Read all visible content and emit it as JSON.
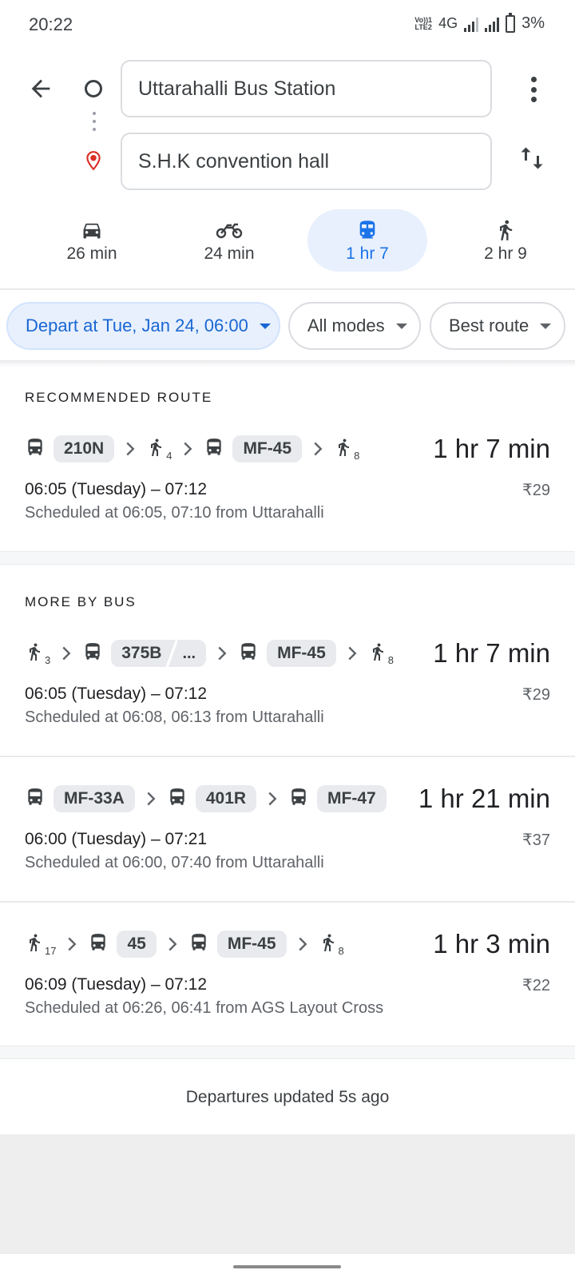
{
  "status": {
    "time": "20:22",
    "volte_line1": "Vo))1",
    "volte_line2": "LTE2",
    "network": "4G",
    "battery": "3%"
  },
  "search": {
    "origin": "Uttarahalli Bus Station",
    "destination": "S.H.K convention hall"
  },
  "modes": [
    {
      "label": "26 min",
      "icon": "car-icon"
    },
    {
      "label": "24 min",
      "icon": "motorcycle-icon"
    },
    {
      "label": "1 hr 7",
      "icon": "transit-icon",
      "selected": true
    },
    {
      "label": "2 hr 9",
      "icon": "walk-icon"
    }
  ],
  "filters": {
    "depart": "Depart at Tue, Jan 24, 06:00",
    "modes": "All modes",
    "sort": "Best route"
  },
  "recommended": {
    "title": "RECOMMENDED ROUTE",
    "route": {
      "steps": [
        {
          "type": "bus",
          "label": "210N"
        },
        {
          "type": "walk",
          "minutes": "4"
        },
        {
          "type": "bus",
          "label": "MF-45"
        },
        {
          "type": "walk",
          "minutes": "8"
        }
      ],
      "duration": "1 hr 7 min",
      "times": "06:05 (Tuesday) – 07:12",
      "schedule": "Scheduled at 06:05, 07:10 from Uttarahalli",
      "fare": "₹29"
    }
  },
  "more_by_bus": {
    "title": "MORE BY BUS",
    "routes": [
      {
        "steps": [
          {
            "type": "walk",
            "minutes": "3"
          },
          {
            "type": "bus",
            "label": "375B",
            "extra": "..."
          },
          {
            "type": "bus",
            "label": "MF-45"
          },
          {
            "type": "walk",
            "minutes": "8"
          }
        ],
        "duration": "1 hr 7 min",
        "times": "06:05 (Tuesday) – 07:12",
        "schedule": "Scheduled at 06:08, 06:13 from Uttarahalli",
        "fare": "₹29"
      },
      {
        "steps": [
          {
            "type": "bus",
            "label": "MF-33A"
          },
          {
            "type": "bus",
            "label": "401R"
          },
          {
            "type": "bus",
            "label": "MF-47"
          }
        ],
        "duration": "1 hr 21 min",
        "times": "06:00 (Tuesday) – 07:21",
        "schedule": "Scheduled at 06:00, 07:40 from Uttarahalli",
        "fare": "₹37"
      },
      {
        "steps": [
          {
            "type": "walk",
            "minutes": "17"
          },
          {
            "type": "bus",
            "label": "45"
          },
          {
            "type": "bus",
            "label": "MF-45"
          },
          {
            "type": "walk",
            "minutes": "8"
          }
        ],
        "duration": "1 hr 3 min",
        "times": "06:09 (Tuesday) – 07:12",
        "schedule": "Scheduled at 06:26, 06:41 from AGS Layout Cross",
        "fare": "₹22"
      }
    ]
  },
  "footer": {
    "departures_updated": "Departures updated 5s ago"
  },
  "colors": {
    "accent": "#1a73e8",
    "accent_bg": "#e8f0fe",
    "pin_red": "#d93025",
    "badge_bg": "#e8eaed"
  }
}
